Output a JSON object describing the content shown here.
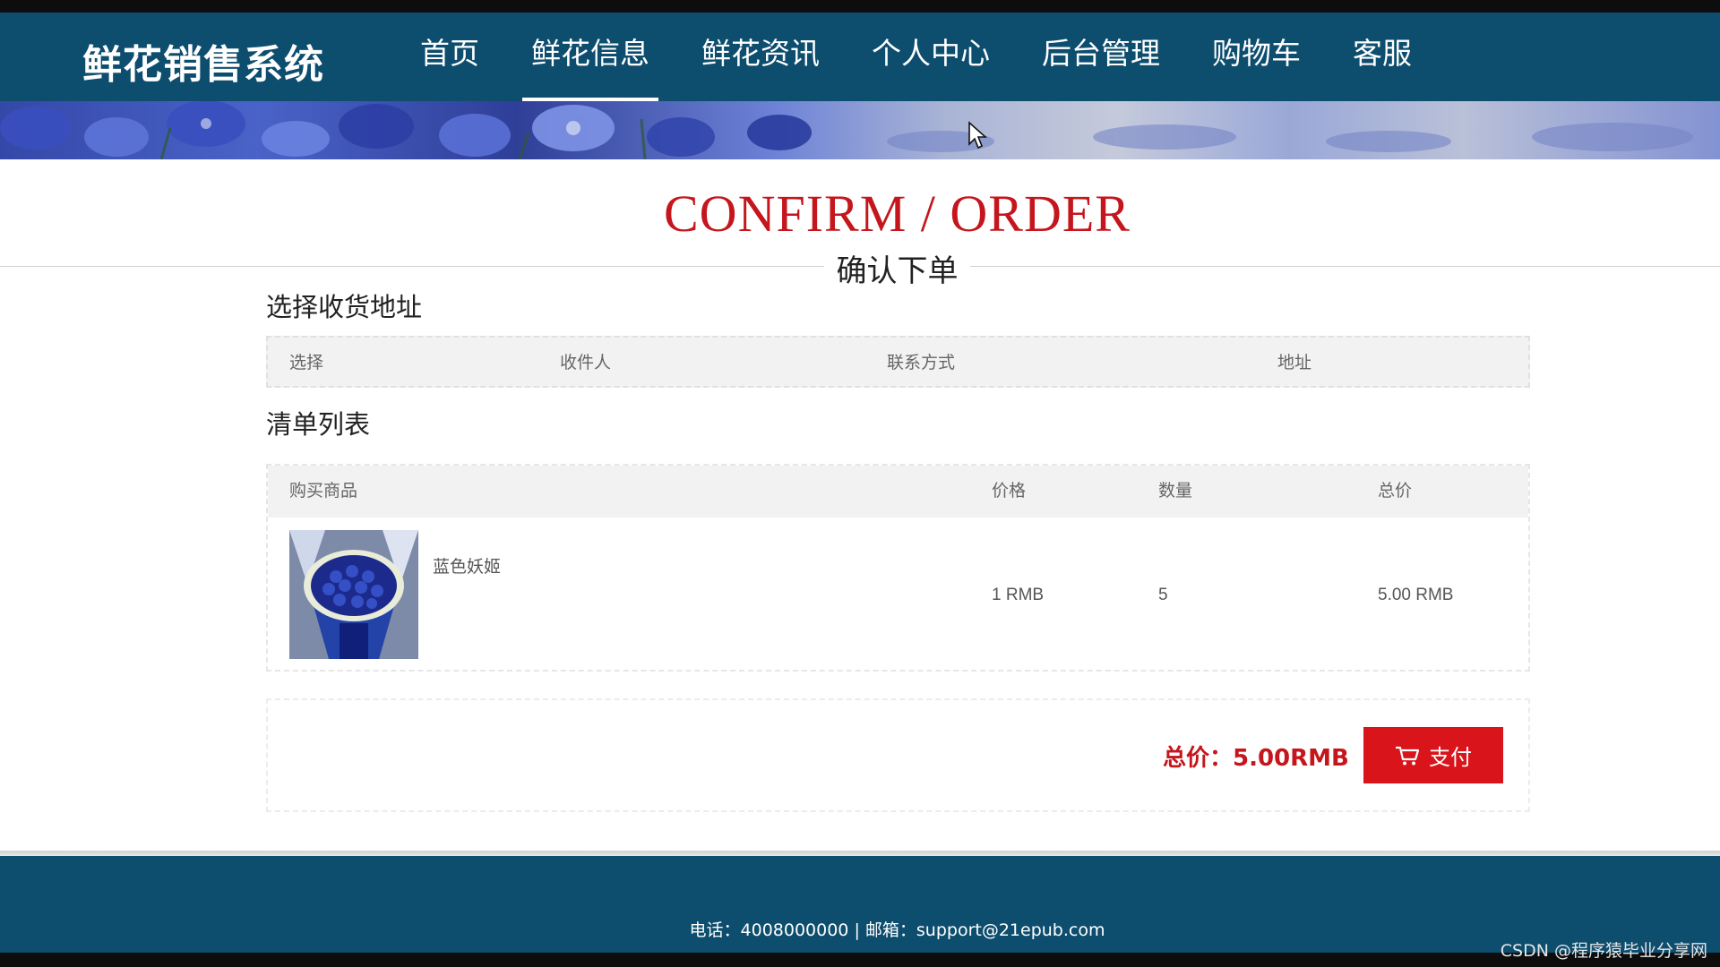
{
  "header": {
    "brand": "鲜花销售系统",
    "nav": [
      {
        "label": "首页"
      },
      {
        "label": "鲜花信息",
        "active": true
      },
      {
        "label": "鲜花资讯"
      },
      {
        "label": "个人中心"
      },
      {
        "label": "后台管理"
      },
      {
        "label": "购物车"
      },
      {
        "label": "客服"
      }
    ]
  },
  "page": {
    "title_en": "CONFIRM / ORDER",
    "title_cn": "确认下单"
  },
  "address_section": {
    "title": "选择收货地址",
    "columns": [
      "选择",
      "收件人",
      "联系方式",
      "地址"
    ]
  },
  "order_section": {
    "title": "清单列表",
    "columns": [
      "购买商品",
      "价格",
      "数量",
      "总价"
    ],
    "items": [
      {
        "name": "蓝色妖姬",
        "price": "1 RMB",
        "quantity": "5",
        "total": "5.00 RMB",
        "image": "blue-rose-bouquet"
      }
    ]
  },
  "summary": {
    "total_label": "总价：5.00RMB",
    "pay_label": "支付",
    "pay_icon": "cart-icon"
  },
  "footer": {
    "contact": "电话：4008000000 | 邮箱：support@21epub.com"
  },
  "watermark": "CSDN @程序猿毕业分享网",
  "colors": {
    "navbar": "#0d4d6e",
    "accent_red": "#c4161c",
    "pay_button": "#d9141b"
  }
}
